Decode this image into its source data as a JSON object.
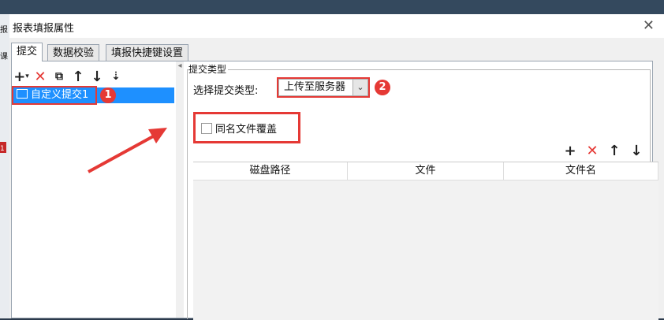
{
  "dialog": {
    "title": "报表填报属性"
  },
  "behind": {
    "mark1": "报",
    "mark2": "课",
    "num": "1"
  },
  "tabs": [
    {
      "label": "提交"
    },
    {
      "label": "数据校验"
    },
    {
      "label": "填报快捷键设置"
    }
  ],
  "left_panel": {
    "tree_item": "自定义提交1"
  },
  "annotations": {
    "badge1": "1",
    "badge2": "2"
  },
  "right_panel": {
    "group_label": "提交类型",
    "select_label": "选择提交类型:",
    "select_value": "上传至服务器",
    "checkbox_label": "同名文件覆盖",
    "columns": [
      "磁盘路径",
      "文件",
      "文件名"
    ]
  },
  "colors": {
    "accent_red": "#e53935",
    "selection_blue": "#1e90ff"
  }
}
